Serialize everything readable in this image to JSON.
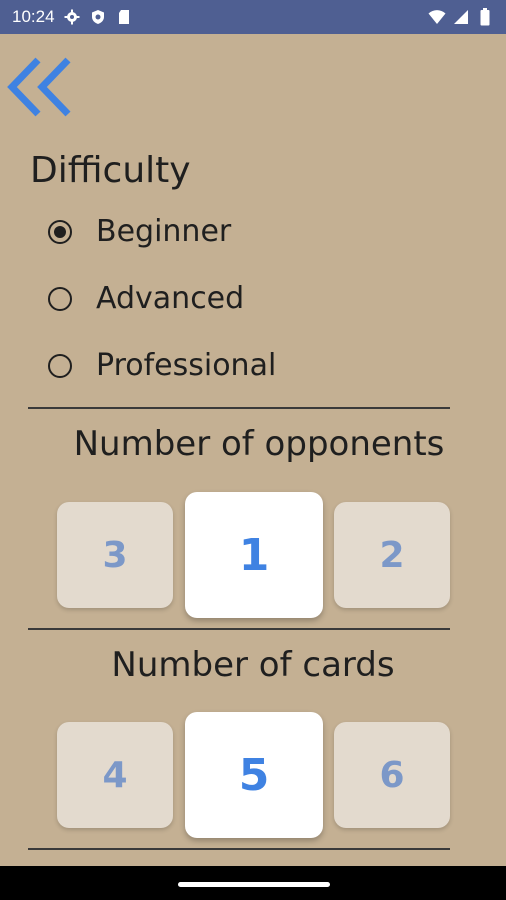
{
  "status_bar": {
    "time": "10:24",
    "left_icons": [
      "gear-icon",
      "shield-icon",
      "sd-card-icon"
    ],
    "right_icons": [
      "wifi-icon",
      "signal-icon",
      "battery-icon"
    ]
  },
  "back_button": {
    "icon": "double-chevron-left-icon",
    "color": "#3f82e2"
  },
  "difficulty": {
    "title": "Difficulty",
    "options": [
      {
        "label": "Beginner",
        "selected": true
      },
      {
        "label": "Advanced",
        "selected": false
      },
      {
        "label": "Professional",
        "selected": false
      }
    ]
  },
  "opponents": {
    "title": "Number of opponents",
    "left": "3",
    "selected": "1",
    "right": "2"
  },
  "cards": {
    "title": "Number of cards",
    "left": "4",
    "selected": "5",
    "right": "6"
  },
  "colors": {
    "background": "#c4b093",
    "status_bar": "#4f5f92",
    "accent": "#3f82e2",
    "tile_inactive_text": "#7c98c8"
  }
}
